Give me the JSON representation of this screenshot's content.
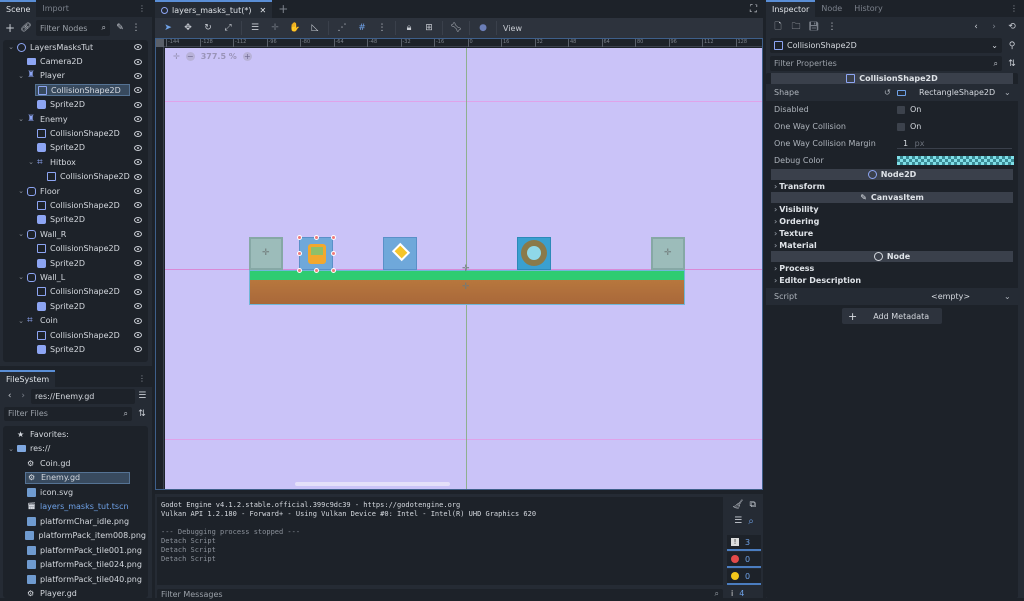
{
  "scene_dock": {
    "tabs": [
      "Scene",
      "Import"
    ],
    "filter_placeholder": "Filter Nodes",
    "tree": [
      {
        "label": "LayersMasksTut",
        "icon": "node2d-icon",
        "depth": 0,
        "fold": true
      },
      {
        "label": "Camera2D",
        "icon": "camera-icon",
        "depth": 1
      },
      {
        "label": "Player",
        "icon": "character-body-icon",
        "depth": 1,
        "fold": true
      },
      {
        "label": "CollisionShape2D",
        "icon": "collision-shape-icon",
        "depth": 2,
        "selected": true
      },
      {
        "label": "Sprite2D",
        "icon": "sprite-icon",
        "depth": 2
      },
      {
        "label": "Enemy",
        "icon": "character-body-icon",
        "depth": 1,
        "fold": true
      },
      {
        "label": "CollisionShape2D",
        "icon": "collision-shape-icon",
        "depth": 2
      },
      {
        "label": "Sprite2D",
        "icon": "sprite-icon",
        "depth": 2
      },
      {
        "label": "Hitbox",
        "icon": "area-icon",
        "depth": 2,
        "fold": true
      },
      {
        "label": "CollisionShape2D",
        "icon": "collision-shape-icon",
        "depth": 3
      },
      {
        "label": "Floor",
        "icon": "static-body-icon",
        "depth": 1,
        "fold": true
      },
      {
        "label": "CollisionShape2D",
        "icon": "collision-shape-icon",
        "depth": 2
      },
      {
        "label": "Sprite2D",
        "icon": "sprite-icon",
        "depth": 2
      },
      {
        "label": "Wall_R",
        "icon": "static-body-icon",
        "depth": 1,
        "fold": true
      },
      {
        "label": "CollisionShape2D",
        "icon": "collision-shape-icon",
        "depth": 2
      },
      {
        "label": "Sprite2D",
        "icon": "sprite-icon",
        "depth": 2
      },
      {
        "label": "Wall_L",
        "icon": "static-body-icon",
        "depth": 1,
        "fold": true
      },
      {
        "label": "CollisionShape2D",
        "icon": "collision-shape-icon",
        "depth": 2
      },
      {
        "label": "Sprite2D",
        "icon": "sprite-icon",
        "depth": 2
      },
      {
        "label": "Coin",
        "icon": "area-icon",
        "depth": 1,
        "fold": true
      },
      {
        "label": "CollisionShape2D",
        "icon": "collision-shape-icon",
        "depth": 2
      },
      {
        "label": "Sprite2D",
        "icon": "sprite-icon",
        "depth": 2
      }
    ]
  },
  "filesystem": {
    "tab": "FileSystem",
    "path": "res://Enemy.gd",
    "filter_placeholder": "Filter Files",
    "items": [
      {
        "label": "Favorites:",
        "icon": "star-icon",
        "depth": 0
      },
      {
        "label": "res://",
        "icon": "folder-icon",
        "depth": 0,
        "fold": true
      },
      {
        "label": "Coin.gd",
        "icon": "gear-icon",
        "depth": 1
      },
      {
        "label": "Enemy.gd",
        "icon": "gear-icon",
        "depth": 1,
        "selected": true
      },
      {
        "label": "icon.svg",
        "icon": "image-icon",
        "depth": 1
      },
      {
        "label": "layers_masks_tut.tscn",
        "icon": "scene-icon",
        "depth": 1,
        "highlight": true
      },
      {
        "label": "platformChar_idle.png",
        "icon": "image-icon",
        "depth": 1
      },
      {
        "label": "platformPack_item008.png",
        "icon": "image-icon",
        "depth": 1
      },
      {
        "label": "platformPack_tile001.png",
        "icon": "image-icon",
        "depth": 1
      },
      {
        "label": "platformPack_tile024.png",
        "icon": "image-icon",
        "depth": 1
      },
      {
        "label": "platformPack_tile040.png",
        "icon": "image-icon",
        "depth": 1
      },
      {
        "label": "Player.gd",
        "icon": "gear-icon",
        "depth": 1
      }
    ]
  },
  "editor": {
    "scene_tab": "layers_masks_tut(*)",
    "view_menu": "View",
    "zoom_level": "377.5 %",
    "ruler_top": [
      "-144",
      "-128",
      "-112",
      "-96",
      "-80",
      "-64",
      "-48",
      "-32",
      "-16",
      "0",
      "16",
      "32",
      "48",
      "64",
      "80",
      "96",
      "112",
      "128"
    ]
  },
  "output": {
    "lines": [
      {
        "text": "Godot Engine v4.1.2.stable.official.399c9dc39 - https://godotengine.org",
        "bright": true
      },
      {
        "text": "Vulkan API 1.2.180 - Forward+ - Using Vulkan Device #0: Intel - Intel(R) UHD Graphics 620",
        "bright": true
      },
      {
        "text": "",
        "bright": false
      },
      {
        "text": "--- Debugging process stopped ---",
        "bright": false
      },
      {
        "text": "Detach Script",
        "bright": false
      },
      {
        "text": "Detach Script",
        "bright": false
      },
      {
        "text": "Detach Script",
        "bright": false
      }
    ],
    "filter_placeholder": "Filter Messages",
    "counts": {
      "messages": "3",
      "errors": "0",
      "warnings": "0",
      "editor": "4"
    }
  },
  "inspector": {
    "tabs": [
      "Inspector",
      "Node",
      "History"
    ],
    "object": "CollisionShape2D",
    "filter_placeholder": "Filter Properties",
    "section_collision": "CollisionShape2D",
    "shape_label": "Shape",
    "shape_value": "RectangleShape2D",
    "disabled_label": "Disabled",
    "disabled_value": "On",
    "oneway_label": "One Way Collision",
    "oneway_value": "On",
    "margin_label": "One Way Collision Margin",
    "margin_value": "1",
    "margin_unit": "px",
    "debug_color_label": "Debug Color",
    "debug_color": "#7fdfe8",
    "section_node2d": "Node2D",
    "transform": "Transform",
    "section_canvas": "CanvasItem",
    "canvas_subs": [
      "Visibility",
      "Ordering",
      "Texture",
      "Material"
    ],
    "section_node": "Node",
    "node_subs": [
      "Process",
      "Editor Description"
    ],
    "script_label": "Script",
    "script_value": "<empty>",
    "add_metadata": "Add Metadata"
  },
  "colors": {
    "accent": "#5a8ed6",
    "viewport_bg": "#cac3f8",
    "node_icon": "#8da5f3",
    "error": "#e34a4a",
    "warning": "#f3c61b"
  }
}
